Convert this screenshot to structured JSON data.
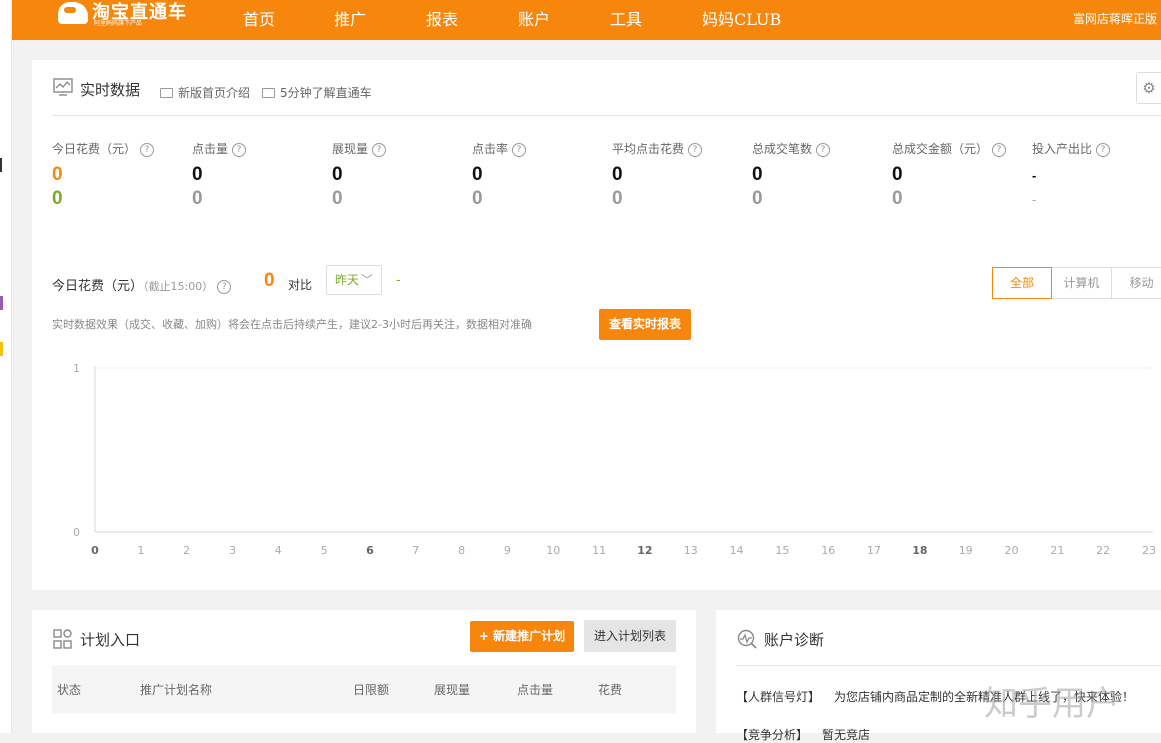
{
  "header": {
    "logo_title": "淘宝直通车",
    "logo_subtitle": "阿里妈妈旗下产品",
    "nav": [
      "首页",
      "推广",
      "报表",
      "账户",
      "工具",
      "妈妈CLUB"
    ],
    "user": "富网店蒋晖正版"
  },
  "realtime": {
    "title": "实时数据",
    "links": [
      "新版首页介绍",
      "5分钟了解直通车"
    ],
    "settings_icon": "⚙",
    "metrics": [
      {
        "label": "今日花费（元）",
        "today": "0",
        "yesterday": "0"
      },
      {
        "label": "点击量",
        "today": "0",
        "yesterday": "0"
      },
      {
        "label": "展现量",
        "today": "0",
        "yesterday": "0"
      },
      {
        "label": "点击率",
        "today": "0",
        "yesterday": "0"
      },
      {
        "label": "平均点击花费",
        "today": "0",
        "yesterday": "0"
      },
      {
        "label": "总成交笔数",
        "today": "0",
        "yesterday": "0"
      },
      {
        "label": "总成交金额（元）",
        "today": "0",
        "yesterday": "0"
      },
      {
        "label": "投入产出比",
        "today": "-",
        "yesterday": "-"
      }
    ],
    "help_mark": "?",
    "compare": {
      "label": "今日花费（元）",
      "note": "（截止15:00）",
      "value": "0",
      "compare_label": "对比",
      "select_value": "昨天",
      "dash": "-"
    },
    "segments": [
      "全部",
      "计算机",
      "移动"
    ],
    "active_segment": "全部",
    "notice": "实时数据效果（成交、收藏、加购）将会在点击后持续产生，建议2-3小时后再关注，数据相对准确",
    "report_button": "查看实时报表"
  },
  "chart_data": {
    "type": "line",
    "x": [
      0,
      1,
      2,
      3,
      4,
      5,
      6,
      7,
      8,
      9,
      10,
      11,
      12,
      13,
      14,
      15,
      16,
      17,
      18,
      19,
      20,
      21,
      22,
      23
    ],
    "x_ticks": [
      "0",
      "1",
      "2",
      "3",
      "4",
      "5",
      "6",
      "7",
      "8",
      "9",
      "10",
      "11",
      "12",
      "13",
      "14",
      "15",
      "16",
      "17",
      "18",
      "19",
      "20",
      "21",
      "22",
      "23"
    ],
    "bold_ticks": [
      "0",
      "6",
      "12",
      "18"
    ],
    "y_ticks": [
      "1",
      "0"
    ],
    "ylim": [
      0,
      1
    ],
    "series": []
  },
  "plans": {
    "title": "计划入口",
    "new_button": "+ 新建推广计划",
    "list_button": "进入计划列表",
    "columns": [
      "状态",
      "推广计划名称",
      "日限额",
      "展现量",
      "点击量",
      "花费"
    ]
  },
  "diagnosis": {
    "title": "账户诊断",
    "rows": [
      {
        "tag": "【人群信号灯】",
        "text": "为您店铺内商品定制的全新精准人群上线了，快来体验！"
      },
      {
        "tag": "【竞争分析】",
        "text": "暂无竞店"
      }
    ]
  },
  "watermark": "知乎用户",
  "colors": {
    "brand": "#f7860d",
    "green": "#7aab2a"
  }
}
